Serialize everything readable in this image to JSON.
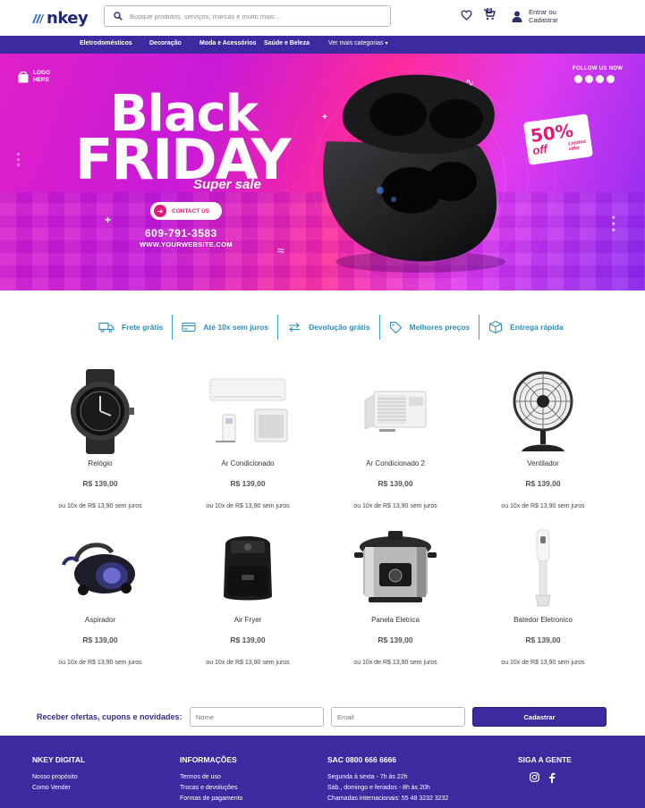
{
  "header": {
    "logo_text": "nkey",
    "search_placeholder": "Busque produtos, serviços, marcas e muito mais ...",
    "cart_count": "0",
    "login_line1": "Entrar ou",
    "login_line2": "Cadastrar",
    "icons": [
      "search-icon",
      "heart-icon",
      "cart-icon",
      "user-icon"
    ]
  },
  "nav": {
    "items": [
      "Eletrodomésticos",
      "Decoração",
      "Moda e Acessórios",
      "Saúde e Beleza",
      "Ver mais categorias"
    ]
  },
  "hero": {
    "logo_line1": "LOGO",
    "logo_line2": "HERE",
    "follow": "FOLLOW US NOW",
    "title1": "Black",
    "title2": "FRIDAY",
    "subtitle": "Super sale",
    "contact": "CONTACT US",
    "phone": "609-791-3583",
    "website": "WWW.YOURWEBSITE.COM",
    "promo_pct": "50%",
    "promo_off": "off",
    "promo_limited1": "Limited",
    "promo_limited2": "offer"
  },
  "features": [
    {
      "label": "Frete grátis",
      "icon": "truck-icon"
    },
    {
      "label": "Até 10x sem juros",
      "icon": "credit-card-icon"
    },
    {
      "label": "Devolução grátis",
      "icon": "exchange-icon"
    },
    {
      "label": "Melhores preços",
      "icon": "price-tag-icon"
    },
    {
      "label": "Entrega rápida",
      "icon": "package-icon"
    }
  ],
  "products": [
    {
      "name": "Relógio",
      "price": "R$ 139,00",
      "installments": "ou 10x de R$ 13,90 sem juros"
    },
    {
      "name": "Ar Condicionado",
      "price": "R$ 139,00",
      "installments": "ou 10x de R$ 13,90 sem juros"
    },
    {
      "name": "Ar Condicionado 2",
      "price": "R$ 139,00",
      "installments": "ou 10x de R$ 13,90 sem juros"
    },
    {
      "name": "Ventilador",
      "price": "R$ 139,00",
      "installments": "ou 10x de R$ 13,90 sem juros"
    },
    {
      "name": "Aspirador",
      "price": "R$ 139,00",
      "installments": "ou 10x de R$ 13,90 sem juros"
    },
    {
      "name": "Air Fryer",
      "price": "R$ 139,00",
      "installments": "ou 10x de R$ 13,90 sem juros"
    },
    {
      "name": "Panela Eletrica",
      "price": "R$ 139,00",
      "installments": "ou 10x de R$ 13,90 sem juros"
    },
    {
      "name": "Batedor Eletronico",
      "price": "R$ 139,00",
      "installments": "ou 10x de R$ 13,90 sem juros"
    }
  ],
  "newsletter": {
    "label": "Receber ofertas, cupons e novidades:",
    "name_placeholder": "Nome",
    "email_placeholder": "Email",
    "button": "Cadastrar"
  },
  "footer": {
    "col1": {
      "title": "NKEY DIGITAL",
      "links": [
        "Nosso propósito",
        "Como Vender"
      ]
    },
    "col2": {
      "title": "INFORMAÇÕES",
      "links": [
        "Termos de uso",
        "Trocas e devoluções",
        "Formas de pagamento"
      ]
    },
    "col3": {
      "title": "SAC 0800 666 6666",
      "lines": [
        "Segunda à sexta - 7h às 22h",
        "Sáb., domingo e feriados - 8h às 20h",
        "Chamadas internacionais: 55 48 3232 3232"
      ]
    },
    "col4": {
      "title": "SIGA A GENTE",
      "icons": [
        "instagram-icon",
        "facebook-icon"
      ]
    }
  },
  "colors": {
    "brand": "#3d2aa0",
    "accent": "#2a8fbd",
    "hero_pink": "#e0197a"
  }
}
